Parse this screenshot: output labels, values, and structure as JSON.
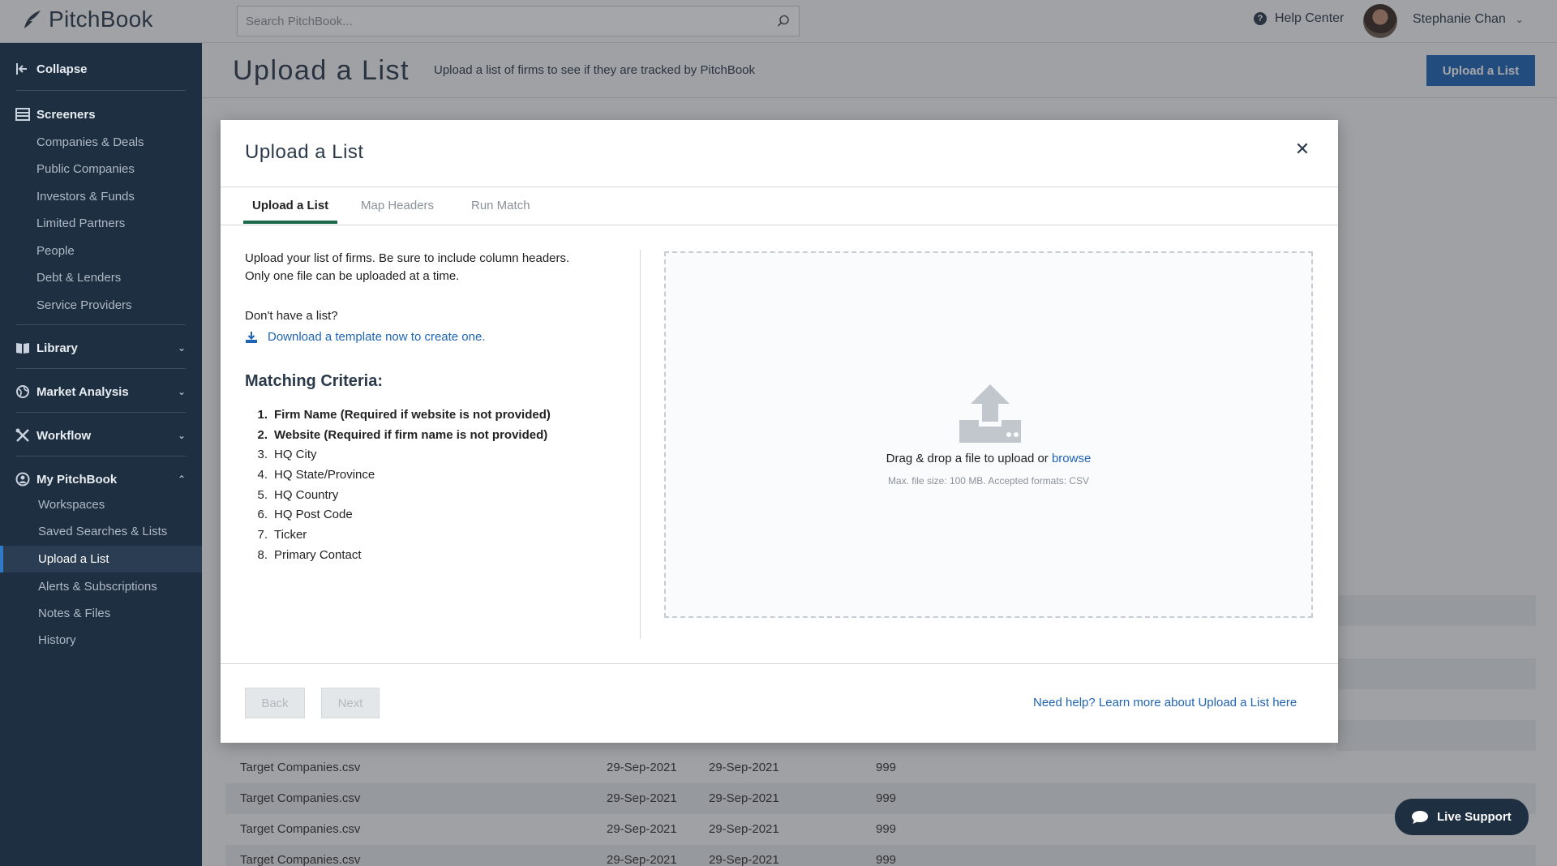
{
  "app": {
    "brand": "PitchBook"
  },
  "topbar": {
    "search_placeholder": "Search PitchBook...",
    "help_label": "Help Center",
    "user_name": "Stephanie Chan"
  },
  "sidebar": {
    "collapse": "Collapse",
    "screeners": {
      "label": "Screeners",
      "items": [
        "Companies & Deals",
        "Public Companies",
        "Investors & Funds",
        "Limited Partners",
        "People",
        "Debt & Lenders",
        "Service Providers"
      ]
    },
    "library": "Library",
    "market_analysis": "Market Analysis",
    "workflow": "Workflow",
    "my_pitchbook": {
      "label": "My PitchBook",
      "items": [
        "Workspaces",
        "Saved Searches & Lists",
        "Upload a List",
        "Alerts & Subscriptions",
        "Notes & Files",
        "History"
      ],
      "active_item": "Upload a List"
    }
  },
  "page": {
    "title": "Upload a List",
    "subtitle": "Upload a list of firms to see if they are tracked by PitchBook",
    "button": "Upload a List"
  },
  "table": {
    "rows": [
      {
        "name": "Target Companies.csv",
        "date1": "29-Sep-2021",
        "date2": "29-Sep-2021",
        "count": "999"
      },
      {
        "name": "Target Companies.csv",
        "date1": "29-Sep-2021",
        "date2": "29-Sep-2021",
        "count": "999"
      },
      {
        "name": "Target Companies.csv",
        "date1": "29-Sep-2021",
        "date2": "29-Sep-2021",
        "count": "999"
      },
      {
        "name": "Target Companies.csv",
        "date1": "29-Sep-2021",
        "date2": "29-Sep-2021",
        "count": "999"
      }
    ]
  },
  "modal": {
    "title": "Upload a List",
    "tabs": [
      "Upload a List",
      "Map Headers",
      "Run Match"
    ],
    "intro_line1": "Upload your list of firms. Be sure to include column headers.",
    "intro_line2": "Only one file can be uploaded at a time.",
    "no_list": "Don't have a list?",
    "download_link": "Download a template now to create one.",
    "criteria_title": "Matching Criteria:",
    "criteria": [
      {
        "num": "1.",
        "text": "Firm Name (Required if website is not provided)"
      },
      {
        "num": "2.",
        "text": "Website (Required if firm name is not provided)"
      },
      {
        "num": "3.",
        "text": "HQ City"
      },
      {
        "num": "4.",
        "text": "HQ State/Province"
      },
      {
        "num": "5.",
        "text": "HQ Country"
      },
      {
        "num": "6.",
        "text": "HQ Post Code"
      },
      {
        "num": "7.",
        "text": "Ticker"
      },
      {
        "num": "8.",
        "text": "Primary Contact"
      }
    ],
    "dropzone_text": "Drag & drop a file to upload or",
    "browse": "browse",
    "dropzone_sub": "Max. file size: 100 MB. Accepted formats: CSV",
    "back": "Back",
    "next": "Next",
    "help_link": "Need help? Learn more about Upload a List here"
  },
  "live_support": "Live Support",
  "colors": {
    "sidebar": "#1e2f41",
    "primary": "#1f64b5",
    "tab_accent": "#1a6a4a"
  }
}
